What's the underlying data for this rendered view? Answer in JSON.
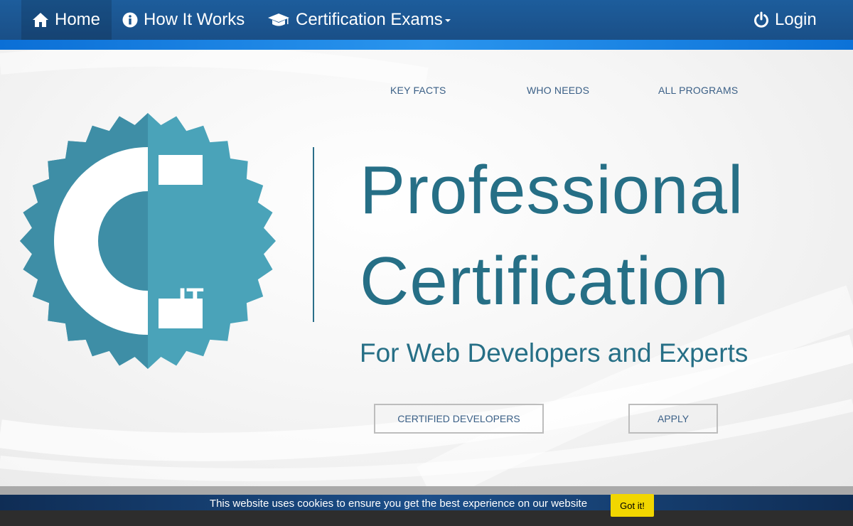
{
  "navbar": {
    "home": "Home",
    "how_it_works": "How It Works",
    "certification_exams": "Certification Exams",
    "login": "Login"
  },
  "subnav": {
    "key_facts": "KEY FACTS",
    "who_needs": "WHO NEEDS",
    "all_programs": "ALL PROGRAMS"
  },
  "hero": {
    "title_line1": "Professional",
    "title_line2": "Certification",
    "tagline": "For Web Developers and Experts",
    "badge_letter": "C",
    "badge_sub": "IT"
  },
  "buttons": {
    "certified_developers": "CERTIFIED DEVELOPERS",
    "apply": "APPLY"
  },
  "cookie": {
    "message": "This website uses cookies to ensure you get the best experience on our website",
    "accept": "Got it!"
  },
  "colors": {
    "navbar": "#1a4f87",
    "accent": "#266f86",
    "badge": "#4aa3b9",
    "cookie_button": "#f1d600"
  },
  "icons": [
    "home-icon",
    "info-icon",
    "graduation-cap-icon",
    "power-icon"
  ]
}
